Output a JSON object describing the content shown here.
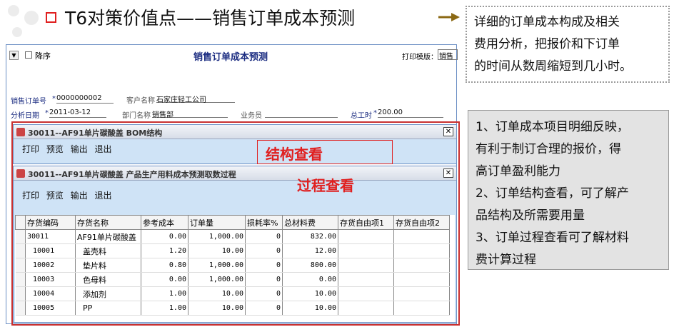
{
  "slide": {
    "title": "T6对策价值点——销售订单成本预测",
    "callout_top": [
      "详细的订单成本构成及相关",
      "费用分析，把报价和下订单",
      "的时间从数周缩短到几小时。"
    ],
    "callout_right": [
      "1、订单成本项目明细反映，",
      "有利于制订合理的报价，得",
      "高订单盈利能力",
      "2、订单结构查看，可了解产",
      "品结构及所需要用量",
      "3、订单过程查看可了解材料",
      "费计算过程"
    ]
  },
  "main_form": {
    "sort_label": "降序",
    "title": "销售订单成本预测",
    "print_template_label": "打印模版：",
    "print_template_value": "销售",
    "order_no_label": "销售订单号",
    "order_no_value": "0000000002",
    "customer_label": "客户名称",
    "customer_value": "石家庄轻工公司",
    "date_label": "分析日期",
    "date_value": "2011-03-12",
    "dept_label": "部门名称",
    "dept_value": "销售部",
    "salesman_label": "业务员",
    "salesman_value": "",
    "total_label": "总工时",
    "total_value": "200.00"
  },
  "bom_window": {
    "title": "30011--AF91单片碳酸盖   BOM结构",
    "menu": [
      "打印",
      "预览",
      "输出",
      "退出"
    ],
    "annotation": "结构查看"
  },
  "process_window": {
    "title": "30011--AF91单片碳酸盖   产品生产用料成本预测取数过程",
    "menu": [
      "打印",
      "预览",
      "输出",
      "退出"
    ],
    "annotation": "过程查看",
    "columns": [
      "存货编码",
      "存货名称",
      "参考成本",
      "订单量",
      "损耗率%",
      "总材料费",
      "存货自由项1",
      "存货自由项2"
    ],
    "rows": [
      [
        "30011",
        "AF91单片碳酸盖",
        "0.00",
        "1,000.00",
        "0",
        "832.00",
        "",
        ""
      ],
      [
        "10001",
        "盖壳料",
        "1.20",
        "10.00",
        "0",
        "12.00",
        "",
        ""
      ],
      [
        "10002",
        "垫片料",
        "0.80",
        "1,000.00",
        "0",
        "800.00",
        "",
        ""
      ],
      [
        "10003",
        "色母料",
        "0.00",
        "1,000.00",
        "0",
        "0.00",
        "",
        ""
      ],
      [
        "10004",
        "添加剂",
        "1.00",
        "10.00",
        "0",
        "10.00",
        "",
        ""
      ],
      [
        "10005",
        "PP",
        "1.00",
        "10.00",
        "0",
        "10.00",
        "",
        ""
      ]
    ]
  },
  "colors": {
    "accent_red": "#e02020",
    "title_blue": "#1a2b80",
    "window_blue": "#cfe3f6",
    "arrow": "#8b6914"
  }
}
